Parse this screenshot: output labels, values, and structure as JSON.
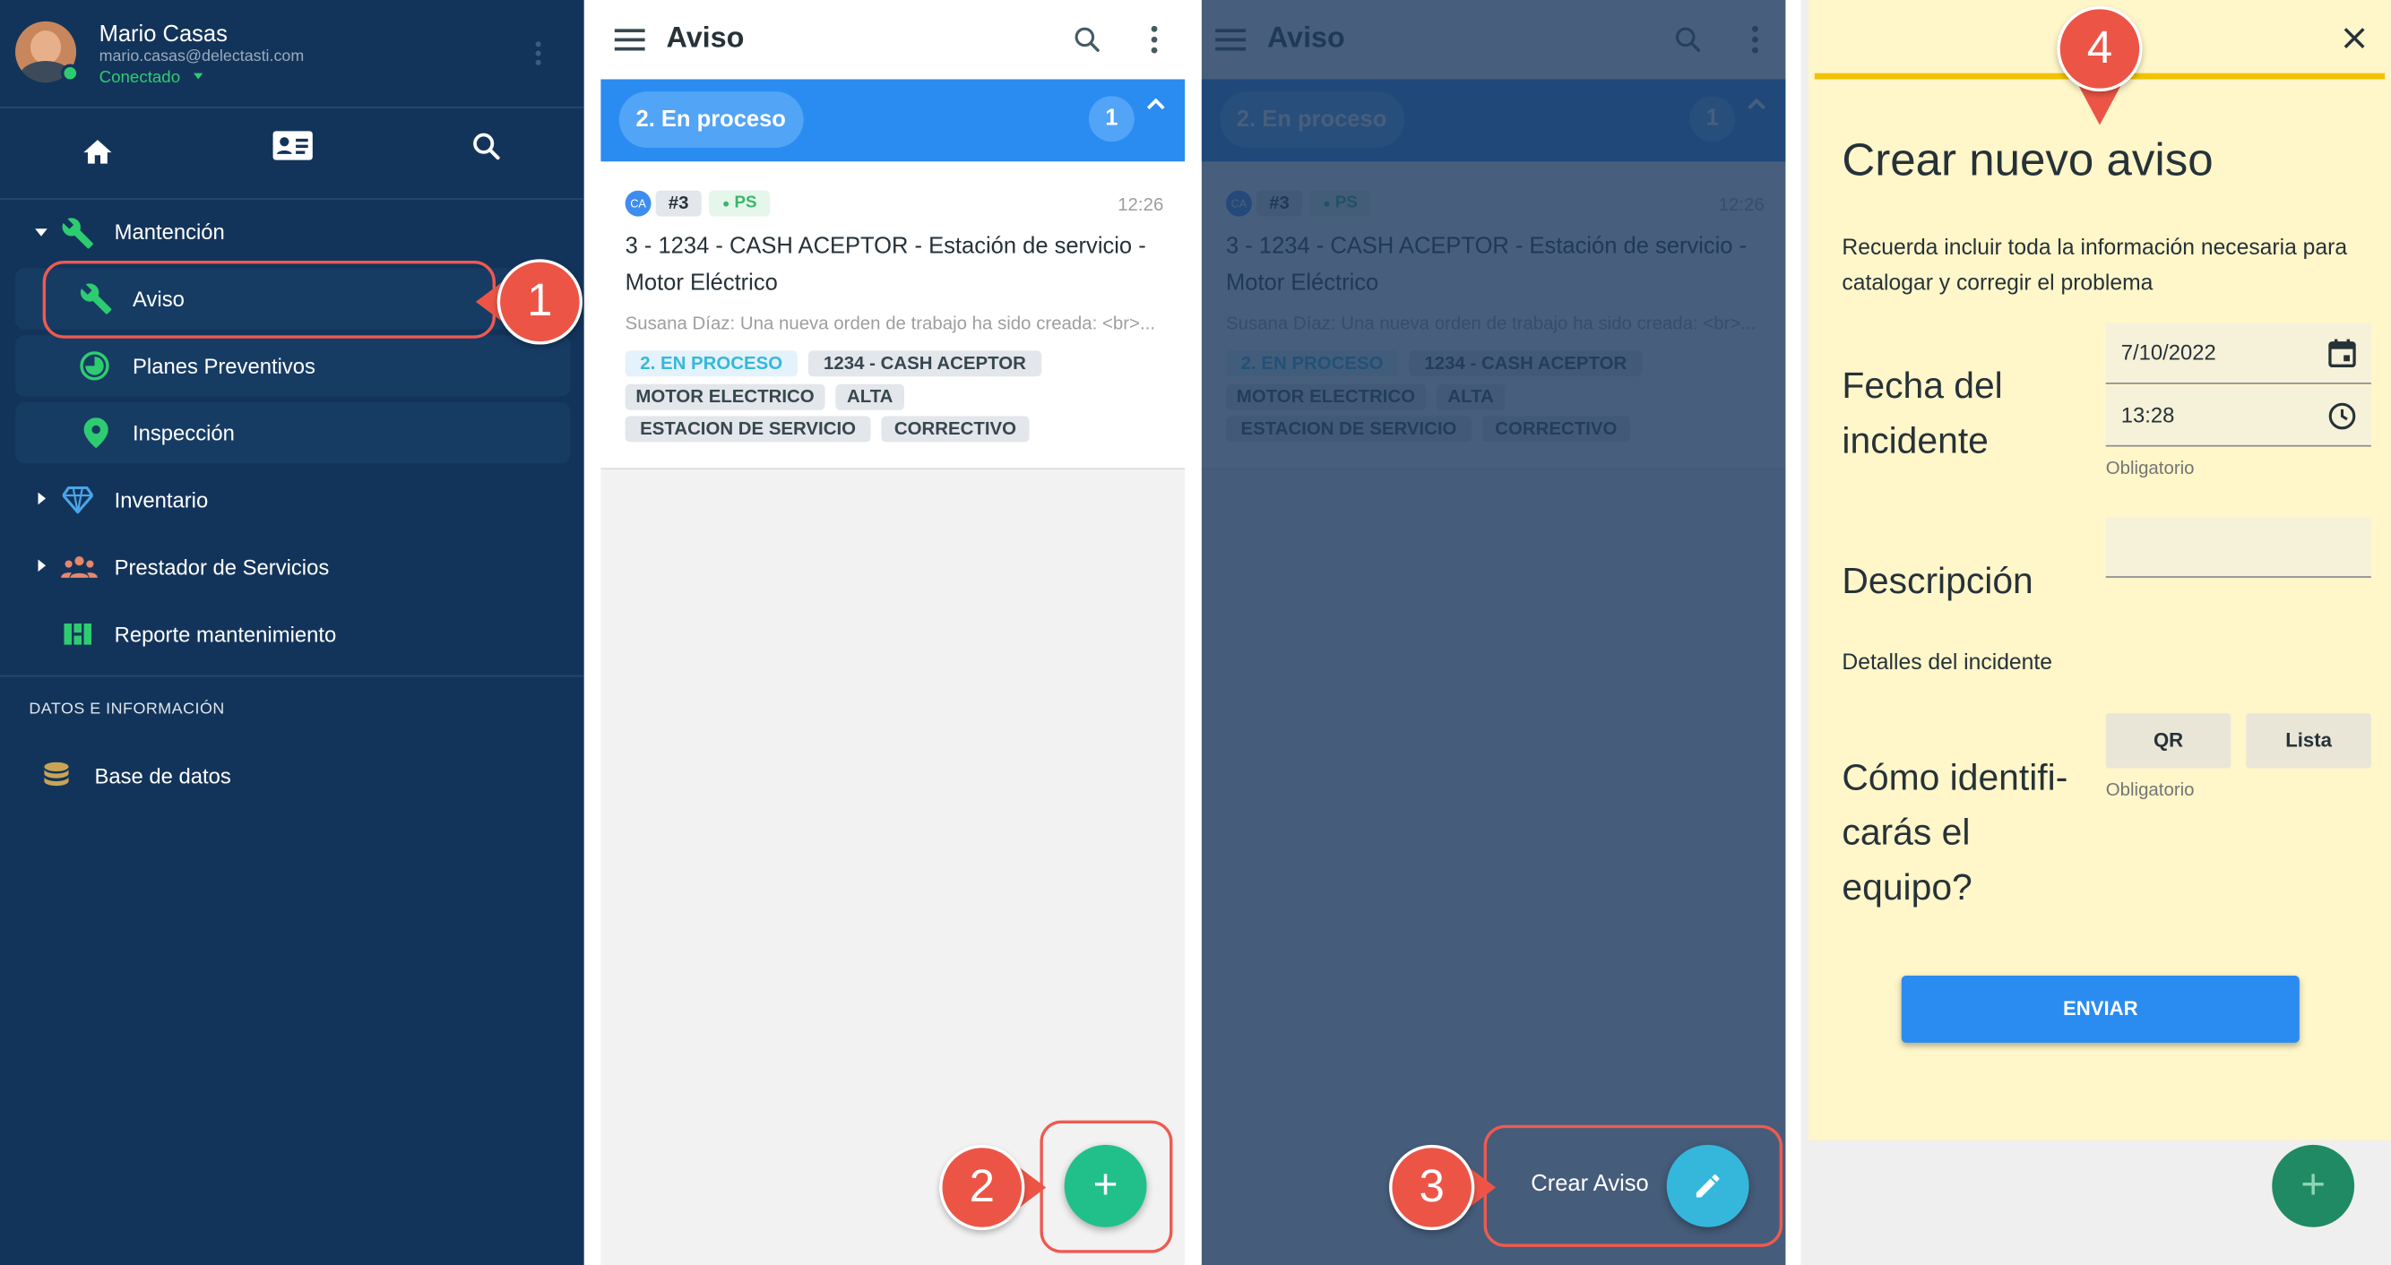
{
  "sidebar": {
    "user": {
      "name": "Mario Casas",
      "email": "mario.casas@delectasti.com",
      "status": "Conectado"
    },
    "menu": [
      {
        "label": "Mantención"
      },
      {
        "label": "Aviso"
      },
      {
        "label": "Planes Preventivos"
      },
      {
        "label": "Inspección"
      },
      {
        "label": "Inventario"
      },
      {
        "label": "Prestador de Servicios"
      },
      {
        "label": "Reporte mantenimiento"
      }
    ],
    "section_label": "DATOS E INFORMACIÓN",
    "database_label": "Base de datos"
  },
  "list_panel": {
    "title": "Aviso",
    "group_label": "2. En proceso",
    "group_count": "1",
    "card": {
      "avatar_initials": "CA",
      "number": "#3",
      "assignee": "PS",
      "time": "12:26",
      "title": "3 - 1234 - CASH ACEPTOR - Estación de servicio - Motor Eléctrico",
      "subtitle": "Susana Díaz: Una nueva orden de trabajo ha sido creada: <br>...",
      "tags": [
        "2. EN PROCESO",
        "1234 - CASH ACEPTOR",
        "MOTOR ELECTRICO",
        "ALTA",
        "ESTACION DE SERVICIO",
        "CORRECTIVO"
      ]
    },
    "fab_label": "+"
  },
  "overlay_panel": {
    "create_label": "Crear Aviso"
  },
  "form": {
    "title": "Crear nuevo aviso",
    "intro": "Recuerda incluir toda la información necesaria para catalogar y corregir el problema",
    "date_label": "Fecha del incidente",
    "date_value": "7/10/2022",
    "time_value": "13:28",
    "required": "Obligatorio",
    "description_label": "Descripción",
    "details_label": "Detalles del incidente",
    "identify_label": "Cómo identifi-carás el equipo?",
    "qr_label": "QR",
    "list_label": "Lista",
    "submit_label": "ENVIAR",
    "fab_label": "+"
  },
  "callouts": [
    "1",
    "2",
    "3",
    "4"
  ],
  "colors": {
    "sidebar_bg": "#13345a",
    "primary_blue": "#2a8cf0",
    "green_accent": "#2ecc71",
    "fab_teal": "#21c08b",
    "form_bg": "#fff6c9",
    "callout_red": "#ec5546"
  }
}
